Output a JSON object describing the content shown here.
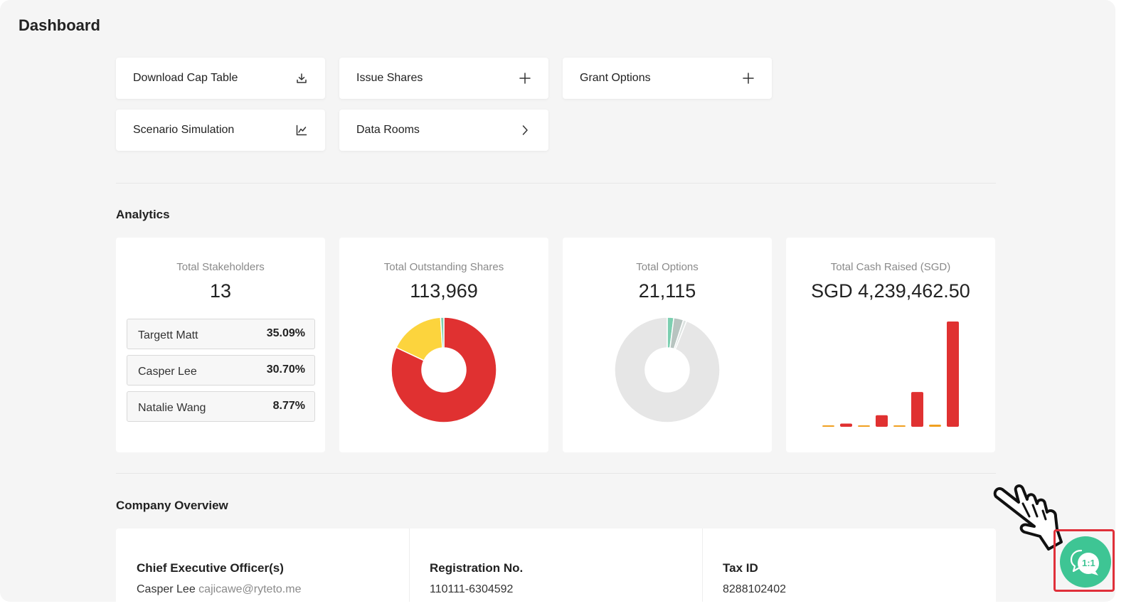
{
  "page": {
    "title": "Dashboard"
  },
  "actions": [
    {
      "label": "Download Cap Table",
      "icon": "download-icon"
    },
    {
      "label": "Issue Shares",
      "icon": "plus-icon"
    },
    {
      "label": "Grant Options",
      "icon": "plus-icon"
    },
    {
      "label": "Scenario Simulation",
      "icon": "line-chart-icon"
    },
    {
      "label": "Data Rooms",
      "icon": "chevron-right-icon"
    }
  ],
  "analytics": {
    "title": "Analytics",
    "stakeholders": {
      "label": "Total Stakeholders",
      "value": "13",
      "top": [
        {
          "name": "Targett Matt",
          "pct": "35.09%"
        },
        {
          "name": "Casper Lee",
          "pct": "30.70%"
        },
        {
          "name": "Natalie Wang",
          "pct": "8.77%"
        }
      ]
    },
    "shares": {
      "label": "Total Outstanding Shares",
      "value": "113,969"
    },
    "options": {
      "label": "Total Options",
      "value": "21,115"
    },
    "cash": {
      "label": "Total Cash Raised (SGD)",
      "value": "SGD 4,239,462.50"
    }
  },
  "overview": {
    "title": "Company Overview",
    "ceo": {
      "label": "Chief Executive Officer(s)",
      "name": "Casper Lee",
      "email": "cajicawe@ryteto.me"
    },
    "registration": {
      "label": "Registration No.",
      "value": "110111-6304592"
    },
    "tax": {
      "label": "Tax ID",
      "value": "8288102402"
    }
  },
  "chat": {
    "label": "1:1",
    "icon": "chat-bubble-icon"
  },
  "colors": {
    "red": "#e03131",
    "yellow": "#fcd43d",
    "teal": "#7ccfb0",
    "grey": "#e6e6e6",
    "green": "#3ec594",
    "orange": "#f0a020"
  },
  "chart_data": [
    {
      "type": "pie",
      "title": "Total Outstanding Shares",
      "values": [
        82,
        17,
        1
      ],
      "colors": [
        "#e03131",
        "#fcd43d",
        "#7ccfb0"
      ]
    },
    {
      "type": "pie",
      "title": "Total Options",
      "values": [
        2,
        3,
        1,
        94
      ],
      "colors": [
        "#7ccfb0",
        "#b8c4c0",
        "#dde3e1",
        "#e6e6e6"
      ]
    },
    {
      "type": "bar",
      "title": "Total Cash Raised (SGD)",
      "series": [
        {
          "values": [
            1,
            3,
            1,
            11,
            1,
            33,
            2,
            100
          ]
        }
      ],
      "colors": [
        "#f0a020",
        "#e03131",
        "#f0a020",
        "#e03131",
        "#f0a020",
        "#e03131",
        "#f0a020",
        "#e03131"
      ]
    }
  ]
}
